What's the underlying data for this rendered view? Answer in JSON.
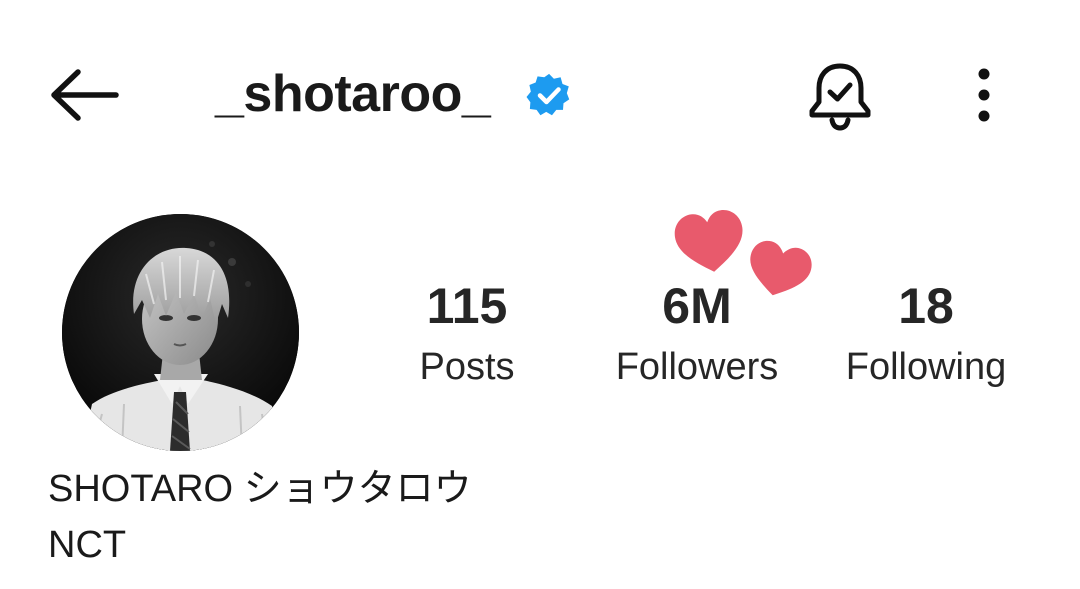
{
  "header": {
    "username": "_shotaroo_",
    "verified": true,
    "back_icon": "arrow-left-icon",
    "notification_icon": "bell-check-icon",
    "more_icon": "more-vertical-icon"
  },
  "profile": {
    "avatar_icon": "profile-photo",
    "display_name": "SHOTARO ショウタロウ",
    "category": "NCT"
  },
  "stats": [
    {
      "value": "115",
      "label": "Posts"
    },
    {
      "value": "6M",
      "label": "Followers"
    },
    {
      "value": "18",
      "label": "Following"
    }
  ],
  "decorations": {
    "hearts_icon": "hearts-sticker",
    "heart_color": "#e85a6c",
    "verified_color": "#1d9bf0"
  }
}
